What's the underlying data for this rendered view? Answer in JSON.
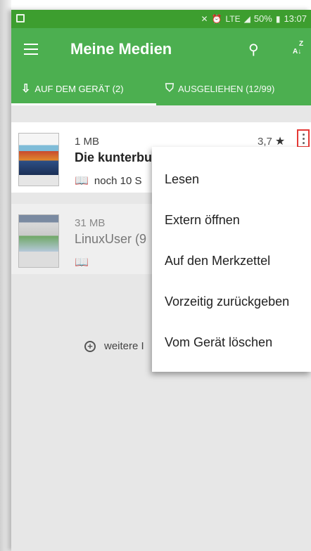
{
  "statusbar": {
    "battery": "50%",
    "time": "13:07",
    "lte": "LTE"
  },
  "appbar": {
    "title": "Meine Medien"
  },
  "tabs": [
    {
      "label": "AUF DEM GERÄT (2)"
    },
    {
      "label": "AUSGELIEHEN (12/99)"
    }
  ],
  "items": [
    {
      "size": "1 MB",
      "title": "Die kunterbu",
      "subtitle": "noch 10 S",
      "rating": "3,7"
    },
    {
      "size": "31 MB",
      "title": "LinuxUser (9",
      "subtitle": ""
    }
  ],
  "more_link": "weitere I",
  "menu": [
    {
      "label": "Lesen"
    },
    {
      "label": "Extern öffnen"
    },
    {
      "label": "Auf den Merkzettel"
    },
    {
      "label": "Vorzeitig zurückgeben"
    },
    {
      "label": "Vom Gerät löschen"
    }
  ],
  "colors": {
    "appbar": "#4caf50",
    "statusbar": "#3d9e2f",
    "highlight": "#e53935"
  }
}
